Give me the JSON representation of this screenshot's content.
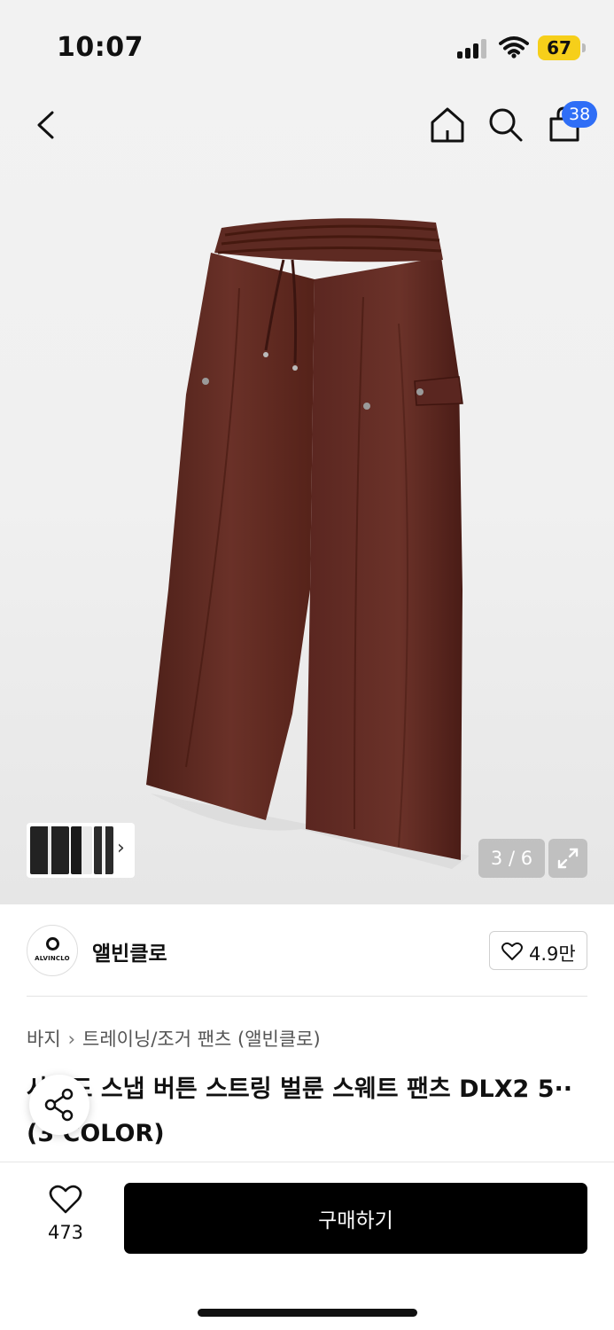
{
  "status_bar": {
    "time": "10:07",
    "battery": "67"
  },
  "header": {
    "cart_count": "38"
  },
  "gallery": {
    "counter": "3 / 6"
  },
  "brand": {
    "name": "앨빈클로",
    "logo_text": "ALVINCLO",
    "likes": "4.9만"
  },
  "breadcrumb": {
    "category": "바지",
    "subcategory": "트레이닝/조거 팬츠 (앨빈클로)"
  },
  "product": {
    "title": "사이드 스냅 버튼 스트링 벌룬 스웨트 팬츠 DLX2 5·· (3 COLOR)"
  },
  "bottom_bar": {
    "wish_count": "473",
    "buy_label": "구매하기"
  },
  "icons": [
    "back-icon",
    "home-icon",
    "search-icon",
    "cart-icon",
    "expand-icon",
    "heart-icon",
    "share-icon",
    "chevron-right-icon"
  ],
  "colors": {
    "accent_badge": "#2f6ef6",
    "battery": "#f6cf1a",
    "buy_button": "#000000",
    "product": "#5a2720"
  }
}
